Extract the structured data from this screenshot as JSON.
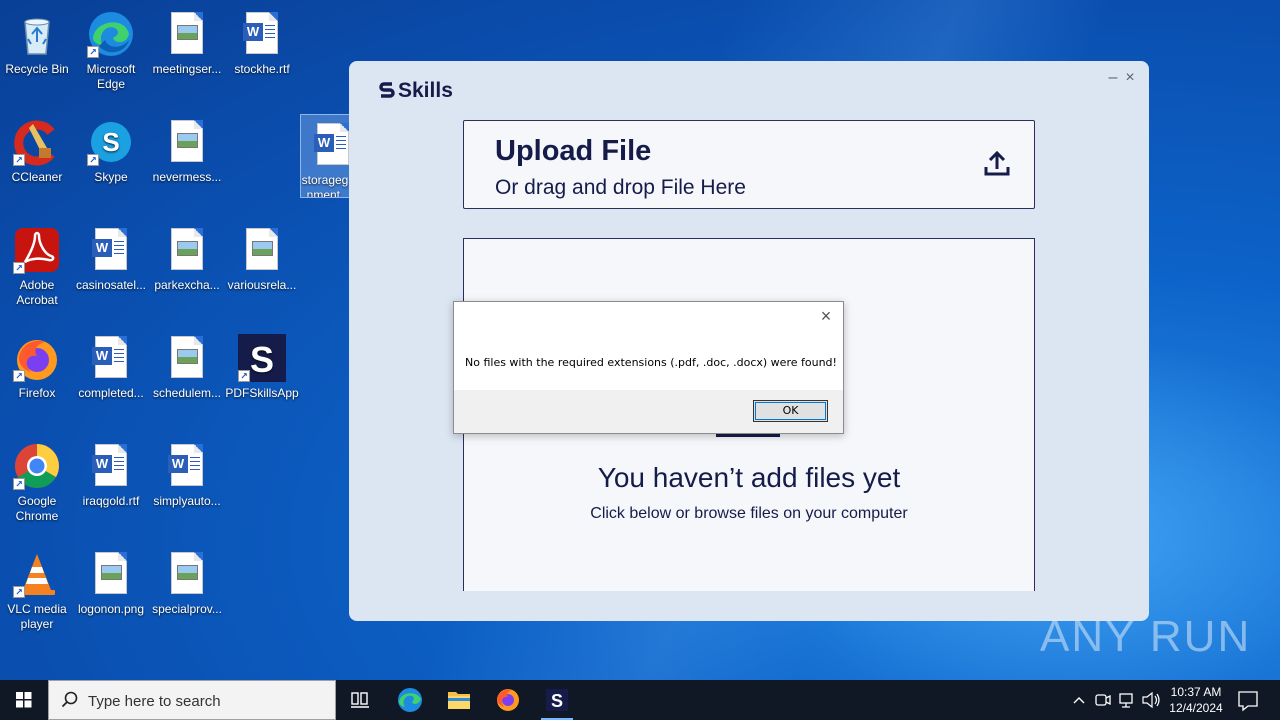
{
  "desktop": {
    "icons": [
      {
        "label": "Recycle Bin",
        "icon": "recycle-bin-icon"
      },
      {
        "label": "Microsoft Edge",
        "icon": "edge-icon"
      },
      {
        "label": "meetingser...",
        "icon": "image-file-icon"
      },
      {
        "label": "stockhe.rtf",
        "icon": "word-file-icon"
      },
      {
        "label": "CCleaner",
        "icon": "ccleaner-icon"
      },
      {
        "label": "Skype",
        "icon": "skype-icon"
      },
      {
        "label": "nevermess...",
        "icon": "image-file-icon"
      },
      {
        "label": "storageg nment.",
        "icon": "word-file-icon"
      },
      {
        "label": "Adobe Acrobat",
        "icon": "acrobat-icon"
      },
      {
        "label": "casinosatel...",
        "icon": "word-file-icon"
      },
      {
        "label": "parkexcha...",
        "icon": "image-file-icon"
      },
      {
        "label": "variousrela...",
        "icon": "image-file-icon"
      },
      {
        "label": "Firefox",
        "icon": "firefox-icon"
      },
      {
        "label": "completed...",
        "icon": "word-file-icon"
      },
      {
        "label": "schedulem...",
        "icon": "image-file-icon"
      },
      {
        "label": "PDFSkillsApp",
        "icon": "pdfskills-icon"
      },
      {
        "label": "Google Chrome",
        "icon": "chrome-icon"
      },
      {
        "label": "iraqgold.rtf",
        "icon": "word-file-icon"
      },
      {
        "label": "simplyauto...",
        "icon": "word-file-icon"
      },
      {
        "label": "VLC media player",
        "icon": "vlc-icon"
      },
      {
        "label": "logonon.png",
        "icon": "image-file-icon"
      },
      {
        "label": "specialprov...",
        "icon": "image-file-icon"
      }
    ]
  },
  "app": {
    "brand": "Skills",
    "upload_title": "Upload File",
    "upload_subtitle": "Or drag and drop File Here",
    "empty_title": "You haven’t add files yet",
    "empty_subtitle": "Click below or browse files on your computer",
    "minimize": "–",
    "close": "×"
  },
  "dialog": {
    "message": "No files with the required extensions (.pdf, .doc, .docx) were found!",
    "ok_label": "OK",
    "close": "×"
  },
  "watermark": "ANY RUN",
  "taskbar": {
    "search_placeholder": "Type here to search",
    "time": "10:37 AM",
    "date": "12/4/2024"
  },
  "colors": {
    "app_bg": "#dce6f3",
    "brand_navy": "#161c4a",
    "taskbar_bg": "#101826"
  }
}
